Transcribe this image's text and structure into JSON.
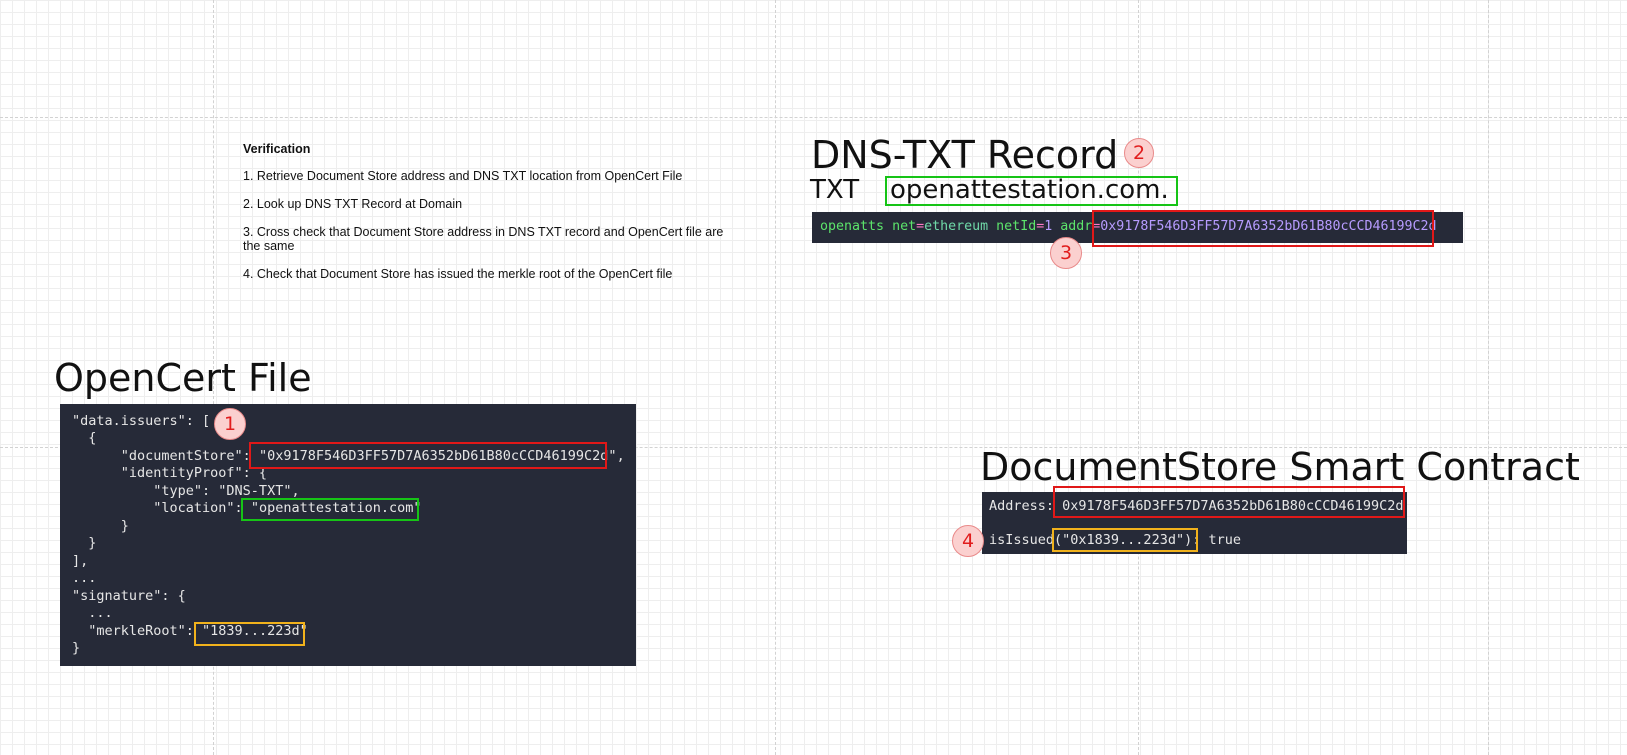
{
  "verification": {
    "title": "Verification",
    "steps": [
      "1. Retrieve Document Store address and DNS TXT location from OpenCert File",
      "2. Look up DNS TXT Record at Domain",
      "3. Cross check that Document Store address in DNS TXT record and OpenCert file are the same",
      "4. Check that Document Store has issued the merkle root of the OpenCert file"
    ]
  },
  "dns": {
    "title": "DNS-TXT Record",
    "badge": "2",
    "record_type": "TXT",
    "domain": "openattestation.com",
    "domain_suffix": ".",
    "code": {
      "k1": "openatts",
      "k2": "net",
      "v2": "ethereum",
      "k3": "netId",
      "v3": "1",
      "k4": "addr",
      "eq": "=",
      "address": "0x9178F546D3FF57D7A6352bD61B80cCCD46199C2d"
    },
    "badge3": "3"
  },
  "opencert": {
    "title": "OpenCert File",
    "badge": "1",
    "lines": {
      "l1": "\"data.issuers\": [",
      "l2": "  {",
      "l3_key": "      \"documentStore\": ",
      "l3_val": "\"0x9178F546D3FF57D7A6352bD61B80cCCD46199C2d\"",
      "l3_end": ",",
      "l4": "      \"identityProof\": {",
      "l5": "          \"type\": \"DNS-TXT\",",
      "l6_key": "          \"location\": ",
      "l6_val": "\"openattestation.com\"",
      "l7": "      }",
      "l8": "  }",
      "l9": "],",
      "l10": "...",
      "l11": "\"signature\": {",
      "l12": "  ...",
      "l13_key": "  \"merkleRoot\": ",
      "l13_val": "\"1839...223d\"",
      "l14": "}"
    }
  },
  "contract": {
    "title": "DocumentStore Smart Contract",
    "address_label": "Address:",
    "address": "0x9178F546D3FF57D7A6352bD61B80cCCD46199C2d",
    "fn_name": "isIssued",
    "fn_arg": "(\"0x1839...223d\"):",
    "result": "true",
    "badge": "4"
  },
  "colors": {
    "panel_bg": "#262a38",
    "match_red": "#e01818",
    "match_green": "#16c416",
    "match_yellow": "#f1b21c",
    "badge_fill": "#fbd0cf"
  }
}
